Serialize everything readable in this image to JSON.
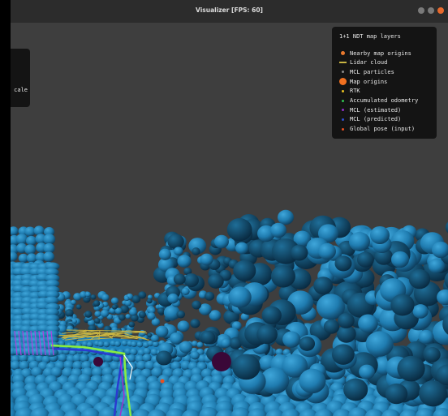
{
  "window": {
    "title": "Visualizer [FPS: 60]",
    "controls": [
      "minimize",
      "maximize",
      "close"
    ]
  },
  "left_panel": {
    "text": "cale"
  },
  "legend": {
    "title": "1+1 NDT map layers",
    "items": [
      {
        "label": "Nearby map origins",
        "color": "#e8792e",
        "icon": "orange-dot"
      },
      {
        "label": "Lidar cloud",
        "color": "#c8b442",
        "icon": "lidar-dash"
      },
      {
        "label": "MCL particles",
        "color": "#8a8a8a",
        "icon": "particle-dot"
      },
      {
        "label": "Map origins",
        "color": "#f07020",
        "icon": "large-orange-dot"
      },
      {
        "label": "RTK",
        "color": "#e8c020",
        "icon": "yellow-dot"
      },
      {
        "label": "Accumulated odometry",
        "color": "#30c050",
        "icon": "green-dot"
      },
      {
        "label": "MCL (estimated)",
        "color": "#9030c8",
        "icon": "purple-dot"
      },
      {
        "label": "MCL (predicted)",
        "color": "#3050d0",
        "icon": "blue-dot"
      },
      {
        "label": "Global pose (input)",
        "color": "#e85020",
        "icon": "red-dot"
      }
    ]
  },
  "colors": {
    "background": "#3e3e3e",
    "titlebar": "#2c2c2c",
    "ndt_cell": "#2a8cc4",
    "ndt_cell_dark": "#16445e",
    "trajectory_green": "#8aee40",
    "trajectory_blue": "#2a3ad0",
    "trajectory_purple": "#a030d0"
  }
}
